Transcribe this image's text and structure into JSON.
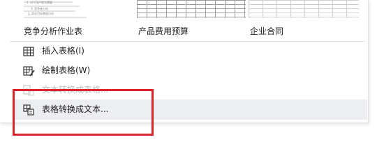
{
  "templates": [
    {
      "label": "竞争分析作业表",
      "preview_lines": [
        "1. 对于用户提交需要",
        "3. 竞争者分析",
        "3. 商业目标数据分析"
      ]
    },
    {
      "label": "产品费用预算"
    },
    {
      "label": "企业合同"
    }
  ],
  "menu": {
    "items": [
      {
        "label": "插入表格(I)",
        "icon": "insert-table-icon",
        "enabled": true
      },
      {
        "label": "绘制表格(W)",
        "icon": "draw-table-icon",
        "enabled": true
      },
      {
        "label": "文本转换成表格...",
        "icon": "text-to-table-icon",
        "enabled": false
      },
      {
        "label": "表格转换成文本...",
        "icon": "table-to-text-icon",
        "enabled": true,
        "hovered": true
      }
    ]
  },
  "colors": {
    "highlight_box": "#d9222a",
    "hover_background": "#eceef2",
    "disabled_text": "#bdbdbd"
  }
}
